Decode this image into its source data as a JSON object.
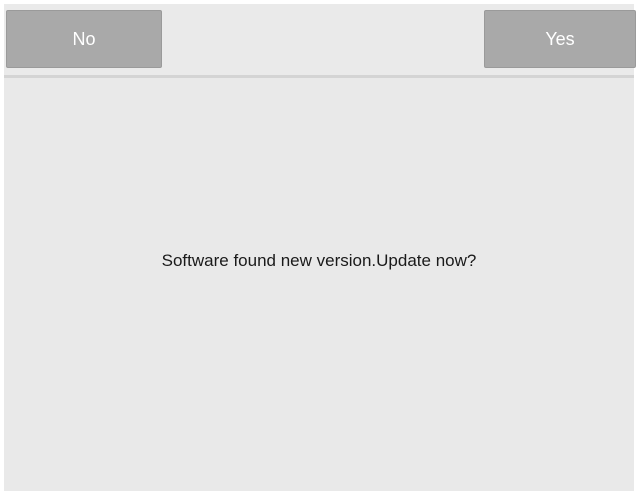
{
  "dialog": {
    "no_label": "No",
    "yes_label": "Yes",
    "message": "Software found new version.Update now?"
  },
  "colors": {
    "background": "#e9e9e9",
    "button": "#a9a9a9",
    "button_text": "#ffffff",
    "message_text": "#1a1a1a",
    "divider": "#d4d4d4"
  }
}
